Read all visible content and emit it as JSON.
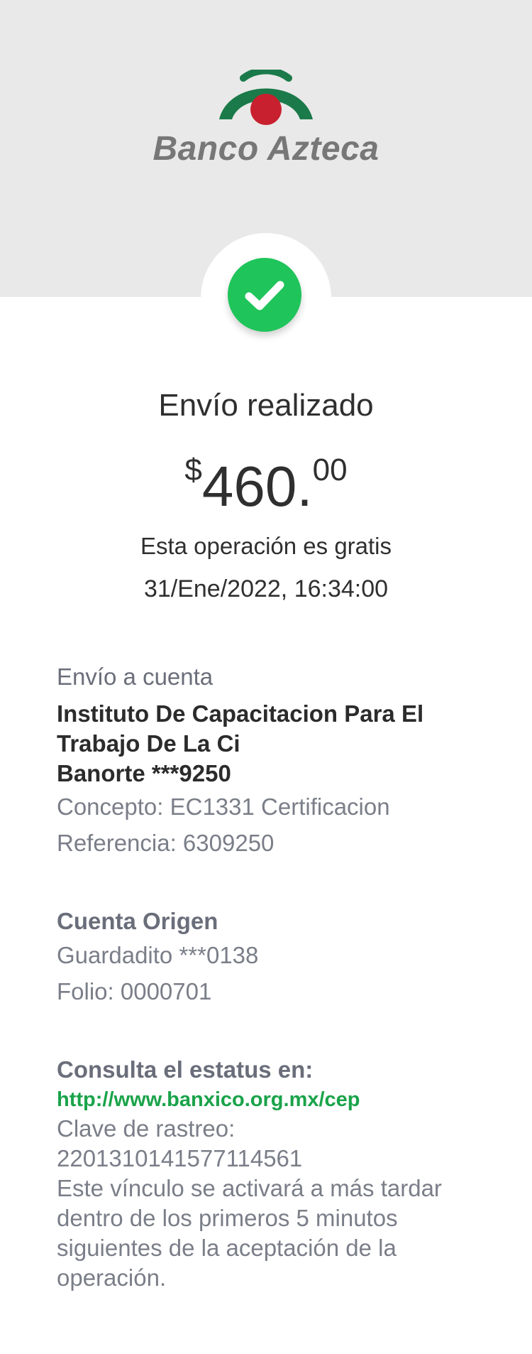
{
  "brand": {
    "name": "Banco Azteca",
    "green": "#1b7a4a",
    "red": "#c8202e",
    "text_color": "#777777"
  },
  "status": {
    "icon": "check-icon",
    "color": "#1fc45a"
  },
  "receipt": {
    "title": "Envío realizado",
    "amount_currency": "$",
    "amount_integer": "460.",
    "amount_decimals": "00",
    "fee_note": "Esta operación es gratis",
    "datetime": "31/Ene/2022, 16:34:00"
  },
  "destination": {
    "label": "Envío a cuenta",
    "name_line1": "Instituto De Capacitacion Para El",
    "name_line2": "Trabajo De La Ci",
    "bank_account": "Banorte ***9250",
    "concept": "Concepto: EC1331 Certificacion",
    "reference": "Referencia: 6309250"
  },
  "origin": {
    "label": "Cuenta Origen",
    "account": "Guardadito ***0138",
    "folio": "Folio: 0000701"
  },
  "status_check": {
    "label": "Consulta el estatus en:",
    "link": "http://www.banxico.org.mx/cep",
    "tracking_label": "Clave de rastreo:",
    "tracking_code": "2201310141577114561",
    "note_line1": "Este vínculo se activará a más tardar",
    "note_line2": "dentro de los primeros 5 minutos",
    "note_line3": "siguientes de la aceptación de la",
    "note_line4": "operación."
  }
}
